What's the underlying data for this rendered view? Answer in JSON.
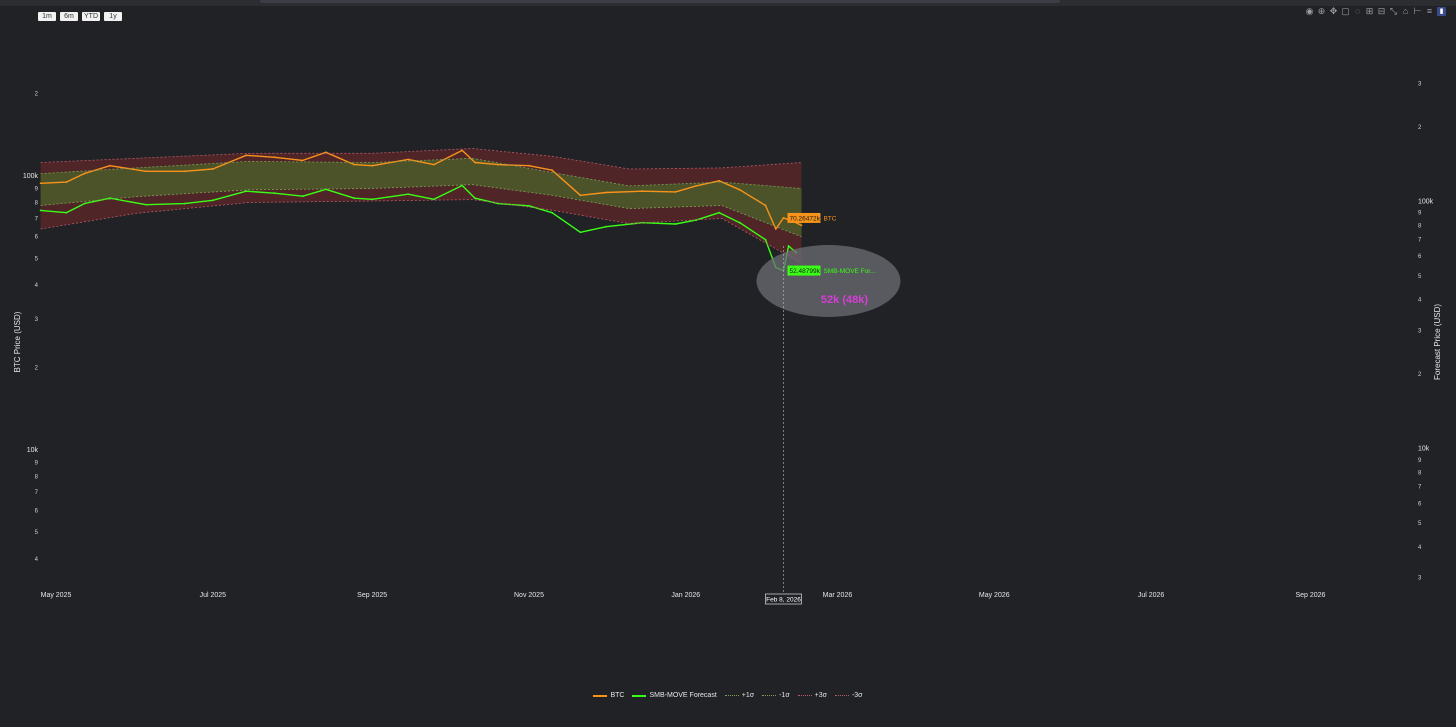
{
  "toolbar": {
    "range_buttons": [
      "1m",
      "6m",
      "YTD",
      "1y"
    ]
  },
  "modebar_icons": [
    "camera-icon",
    "zoom-icon",
    "pan-icon",
    "box-select-icon",
    "lasso-icon",
    "zoom-in-icon",
    "zoom-out-icon",
    "autoscale-icon",
    "reset-axes-icon",
    "spike-lines-icon",
    "compare-hover-icon",
    "plotly-logo-icon"
  ],
  "colors": {
    "background": "#202226",
    "btc": "#f7931a",
    "forecast": "#39ff14",
    "plus1": "#7fa05a",
    "minus1": "#7fa05a",
    "plus3": "#b85a6a",
    "minus3": "#b85a6a",
    "annotation": "#d63fd6"
  },
  "chart_data": {
    "type": "line",
    "y_scale": "log",
    "ylabel_left": "BTC Price (USD)",
    "ylabel_right": "Forecast Price (USD)",
    "xlim": [
      "2025-04-24",
      "2026-09-30"
    ],
    "ylim_left": [
      3000,
      250000
    ],
    "ylim_right": [
      2600,
      350000
    ],
    "x_ticks": [
      "May 2025",
      "Jul 2025",
      "Sep 2025",
      "Nov 2025",
      "Jan 2026",
      "Mar 2026",
      "May 2026",
      "Jul 2026",
      "Sep 2026"
    ],
    "left_ticks": [
      {
        "v": 200000,
        "label": "2"
      },
      {
        "v": 100000,
        "label": "100k"
      },
      {
        "v": 90000,
        "label": "9"
      },
      {
        "v": 80000,
        "label": "8"
      },
      {
        "v": 70000,
        "label": "7"
      },
      {
        "v": 60000,
        "label": "6"
      },
      {
        "v": 50000,
        "label": "5"
      },
      {
        "v": 40000,
        "label": "4"
      },
      {
        "v": 30000,
        "label": "3"
      },
      {
        "v": 20000,
        "label": "2"
      },
      {
        "v": 10000,
        "label": "10k"
      },
      {
        "v": 9000,
        "label": "9"
      },
      {
        "v": 8000,
        "label": "8"
      },
      {
        "v": 7000,
        "label": "7"
      },
      {
        "v": 6000,
        "label": "6"
      },
      {
        "v": 5000,
        "label": "5"
      },
      {
        "v": 4000,
        "label": "4"
      }
    ],
    "right_ticks": [
      {
        "v": 300000,
        "label": "3"
      },
      {
        "v": 200000,
        "label": "2"
      },
      {
        "v": 100000,
        "label": "100k"
      },
      {
        "v": 90000,
        "label": "9"
      },
      {
        "v": 80000,
        "label": "8"
      },
      {
        "v": 70000,
        "label": "7"
      },
      {
        "v": 60000,
        "label": "6"
      },
      {
        "v": 50000,
        "label": "5"
      },
      {
        "v": 40000,
        "label": "4"
      },
      {
        "v": 30000,
        "label": "3"
      },
      {
        "v": 20000,
        "label": "2"
      },
      {
        "v": 10000,
        "label": "10k"
      },
      {
        "v": 9000,
        "label": "9"
      },
      {
        "v": 8000,
        "label": "8"
      },
      {
        "v": 7000,
        "label": "7"
      },
      {
        "v": 6000,
        "label": "6"
      },
      {
        "v": 5000,
        "label": "5"
      },
      {
        "v": 4000,
        "label": "4"
      },
      {
        "v": 3000,
        "label": "3"
      }
    ],
    "series": [
      {
        "name": "BTC",
        "axis": "left",
        "points": [
          [
            "2025-04-25",
            94000
          ],
          [
            "2025-05-05",
            95000
          ],
          [
            "2025-05-12",
            102000
          ],
          [
            "2025-05-22",
            109000
          ],
          [
            "2025-06-05",
            104000
          ],
          [
            "2025-06-20",
            104000
          ],
          [
            "2025-07-01",
            106000
          ],
          [
            "2025-07-14",
            119000
          ],
          [
            "2025-07-25",
            117000
          ],
          [
            "2025-08-05",
            114000
          ],
          [
            "2025-08-14",
            122000
          ],
          [
            "2025-08-25",
            110000
          ],
          [
            "2025-09-01",
            109000
          ],
          [
            "2025-09-15",
            115000
          ],
          [
            "2025-09-25",
            110000
          ],
          [
            "2025-10-06",
            124000
          ],
          [
            "2025-10-11",
            112000
          ],
          [
            "2025-10-20",
            110000
          ],
          [
            "2025-11-01",
            109000
          ],
          [
            "2025-11-10",
            105000
          ],
          [
            "2025-11-21",
            85000
          ],
          [
            "2025-12-01",
            87000
          ],
          [
            "2025-12-15",
            88000
          ],
          [
            "2025-12-28",
            87500
          ],
          [
            "2026-01-05",
            92000
          ],
          [
            "2026-01-14",
            96000
          ],
          [
            "2026-01-22",
            89000
          ],
          [
            "2026-02-01",
            78000
          ],
          [
            "2026-02-05",
            64000
          ],
          [
            "2026-02-08",
            70265
          ],
          [
            "2026-02-12",
            68000
          ],
          [
            "2026-02-15",
            66000
          ]
        ]
      },
      {
        "name": "SMB-MOVE Forecast",
        "axis": "right",
        "points": [
          [
            "2025-04-25",
            92000
          ],
          [
            "2025-05-05",
            90000
          ],
          [
            "2025-05-12",
            98000
          ],
          [
            "2025-05-22",
            103000
          ],
          [
            "2025-06-05",
            97000
          ],
          [
            "2025-06-20",
            98000
          ],
          [
            "2025-07-01",
            101000
          ],
          [
            "2025-07-14",
            110000
          ],
          [
            "2025-07-25",
            108000
          ],
          [
            "2025-08-05",
            105000
          ],
          [
            "2025-08-14",
            112000
          ],
          [
            "2025-08-25",
            103000
          ],
          [
            "2025-09-01",
            102000
          ],
          [
            "2025-09-15",
            107000
          ],
          [
            "2025-09-25",
            102000
          ],
          [
            "2025-10-06",
            116000
          ],
          [
            "2025-10-11",
            103000
          ],
          [
            "2025-10-20",
            98000
          ],
          [
            "2025-11-01",
            96000
          ],
          [
            "2025-11-10",
            90000
          ],
          [
            "2025-11-21",
            75000
          ],
          [
            "2025-12-01",
            79000
          ],
          [
            "2025-12-15",
            82000
          ],
          [
            "2025-12-28",
            81000
          ],
          [
            "2026-01-05",
            84000
          ],
          [
            "2026-01-14",
            90000
          ],
          [
            "2026-01-22",
            82000
          ],
          [
            "2026-02-01",
            70000
          ],
          [
            "2026-02-05",
            54000
          ],
          [
            "2026-02-08",
            52488
          ],
          [
            "2026-02-10",
            66000
          ],
          [
            "2026-02-13",
            62000
          ]
        ]
      },
      {
        "name": "+1σ",
        "axis": "left",
        "dash": true,
        "points": [
          [
            "2025-04-25",
            102000
          ],
          [
            "2025-06-01",
            107000
          ],
          [
            "2025-07-15",
            113000
          ],
          [
            "2025-09-01",
            112000
          ],
          [
            "2025-10-10",
            116000
          ],
          [
            "2025-11-10",
            103000
          ],
          [
            "2025-12-10",
            92000
          ],
          [
            "2026-01-15",
            95000
          ],
          [
            "2026-02-15",
            90000
          ]
        ]
      },
      {
        "name": "-1σ",
        "axis": "left",
        "dash": true,
        "points": [
          [
            "2025-04-25",
            78000
          ],
          [
            "2025-06-01",
            84000
          ],
          [
            "2025-07-15",
            89000
          ],
          [
            "2025-09-01",
            90000
          ],
          [
            "2025-10-10",
            93000
          ],
          [
            "2025-11-10",
            85000
          ],
          [
            "2025-12-10",
            76000
          ],
          [
            "2026-01-15",
            78000
          ],
          [
            "2026-02-15",
            60000
          ]
        ]
      },
      {
        "name": "+3σ",
        "axis": "left",
        "dash": true,
        "points": [
          [
            "2025-04-25",
            112000
          ],
          [
            "2025-06-01",
            116000
          ],
          [
            "2025-07-15",
            121000
          ],
          [
            "2025-09-01",
            121000
          ],
          [
            "2025-10-10",
            126000
          ],
          [
            "2025-11-10",
            118000
          ],
          [
            "2025-12-10",
            106000
          ],
          [
            "2026-01-15",
            107000
          ],
          [
            "2026-02-15",
            112000
          ]
        ]
      },
      {
        "name": "-3σ",
        "axis": "left",
        "dash": true,
        "points": [
          [
            "2025-04-25",
            64000
          ],
          [
            "2025-06-01",
            73000
          ],
          [
            "2025-07-15",
            80000
          ],
          [
            "2025-09-01",
            81000
          ],
          [
            "2025-10-10",
            82000
          ],
          [
            "2025-11-10",
            75000
          ],
          [
            "2025-12-10",
            67000
          ],
          [
            "2026-01-15",
            70000
          ],
          [
            "2026-02-15",
            48000
          ]
        ]
      }
    ],
    "hover": {
      "x": "2026-02-08",
      "x_label": "Feb 8, 2026",
      "labels": [
        {
          "series": "BTC",
          "value_text": "70.26472k",
          "name_text": "BTC",
          "value": 70265
        },
        {
          "series": "SMB-MOVE Forecast",
          "value_text": "52.48799k",
          "name_text": "SMB-MOVE For...",
          "value": 52488
        }
      ]
    },
    "annotation": {
      "text": "52k (48k)"
    },
    "legend": [
      "BTC",
      "SMB-MOVE Forecast",
      "+1σ",
      "-1σ",
      "+3σ",
      "-3σ"
    ],
    "legend_position": "bottom-center",
    "grid": false
  }
}
